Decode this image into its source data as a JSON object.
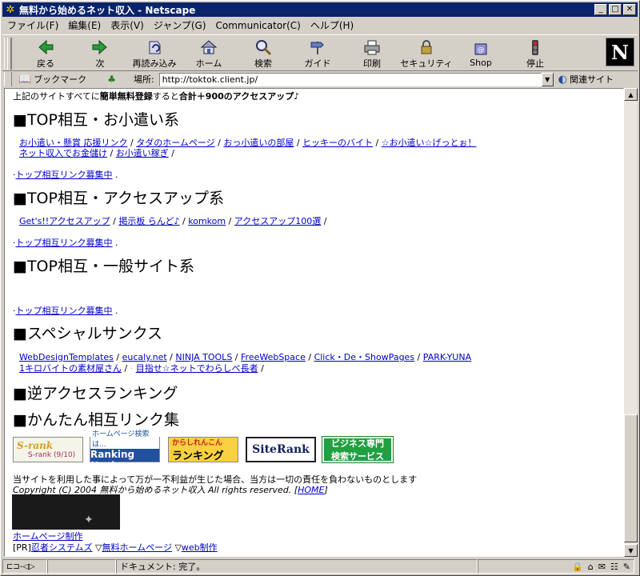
{
  "window": {
    "title": "無料から始めるネット収入 - Netscape"
  },
  "menu": [
    "ファイル(F)",
    "編集(E)",
    "表示(V)",
    "ジャンプ(G)",
    "Communicator(C)",
    "ヘルプ(H)"
  ],
  "toolbar": {
    "back": "戻る",
    "forward": "次",
    "reload": "再読み込み",
    "home": "ホーム",
    "search": "検索",
    "guide": "ガイド",
    "print": "印刷",
    "security": "セキュリティ",
    "shop": "Shop",
    "stop": "停止",
    "logo": "N"
  },
  "location": {
    "bookmarks": "ブックマーク",
    "label": "場所:",
    "url": "http://toktok.client.jp/",
    "related": "関連サイト"
  },
  "content": {
    "intro_text": "上記のサイトすべてに",
    "intro_bold": "簡単無料登録",
    "intro_mid": "すると",
    "intro_bold2": "合計＋900のアクセスアップ♪",
    "section1": "■TOP相互・お小遣い系",
    "s1_links_row1": [
      "お小遣い・懸賞 応援リンク",
      "タダのホームページ",
      "おっ小遣いの部屋",
      "ヒッキーのバイト",
      "☆お小遣い☆げっとぉ！"
    ],
    "s1_links_row2": [
      "ネット収入でお金儲け",
      "お小遣い稼ぎ"
    ],
    "recruit": "トップ相互リンク募集中",
    "section2": "■TOP相互・アクセスアップ系",
    "s2_links": [
      "Get's!!アクセスアップ",
      "掲示板 らんど♪",
      "komkom",
      "アクセスアップ100選"
    ],
    "section3": "■TOP相互・一般サイト系",
    "section4": "■スペシャルサンクス",
    "s4_links_row1": [
      "WebDesignTemplates",
      "eucaly.net",
      "NINJA TOOLS",
      "FreeWebSpace",
      "Click・De・ShowPages",
      "PARK-YUNA"
    ],
    "s4_links_row2": [
      "1キロバイトの素材屋さん",
      "目指せ☆ネットでわらしべ長者"
    ],
    "section5": "■逆アクセスランキング",
    "section6": "■かんたん相互リンク集",
    "banners": {
      "b1_title": "S-rank",
      "b1_sub": "S-rank (9/10)",
      "b2_top": "ホームページ検索は...",
      "b2_main": "Ranking Navi",
      "b3_top": "からしれんこん",
      "b3_main": "ランキング",
      "b4": "SiteRank",
      "b5_top": "ビジネス専門",
      "b5_main": "検索サービス"
    },
    "disclaimer": "当サイトを利用した事によって万が一不利益が生じた場合、当方は一切の責任を負わないものとします",
    "copyright": "Copyright (C) 2004 無料から始めるネット収入 All rights reserved.",
    "home_link": "HOME",
    "hp_link": "ホームページ制作",
    "pr_label": "[PR]",
    "pr_links": [
      "忍者システムズ",
      "無料ホームページ",
      "web制作"
    ]
  },
  "status": {
    "text": "ドキュメント: 完了。"
  }
}
